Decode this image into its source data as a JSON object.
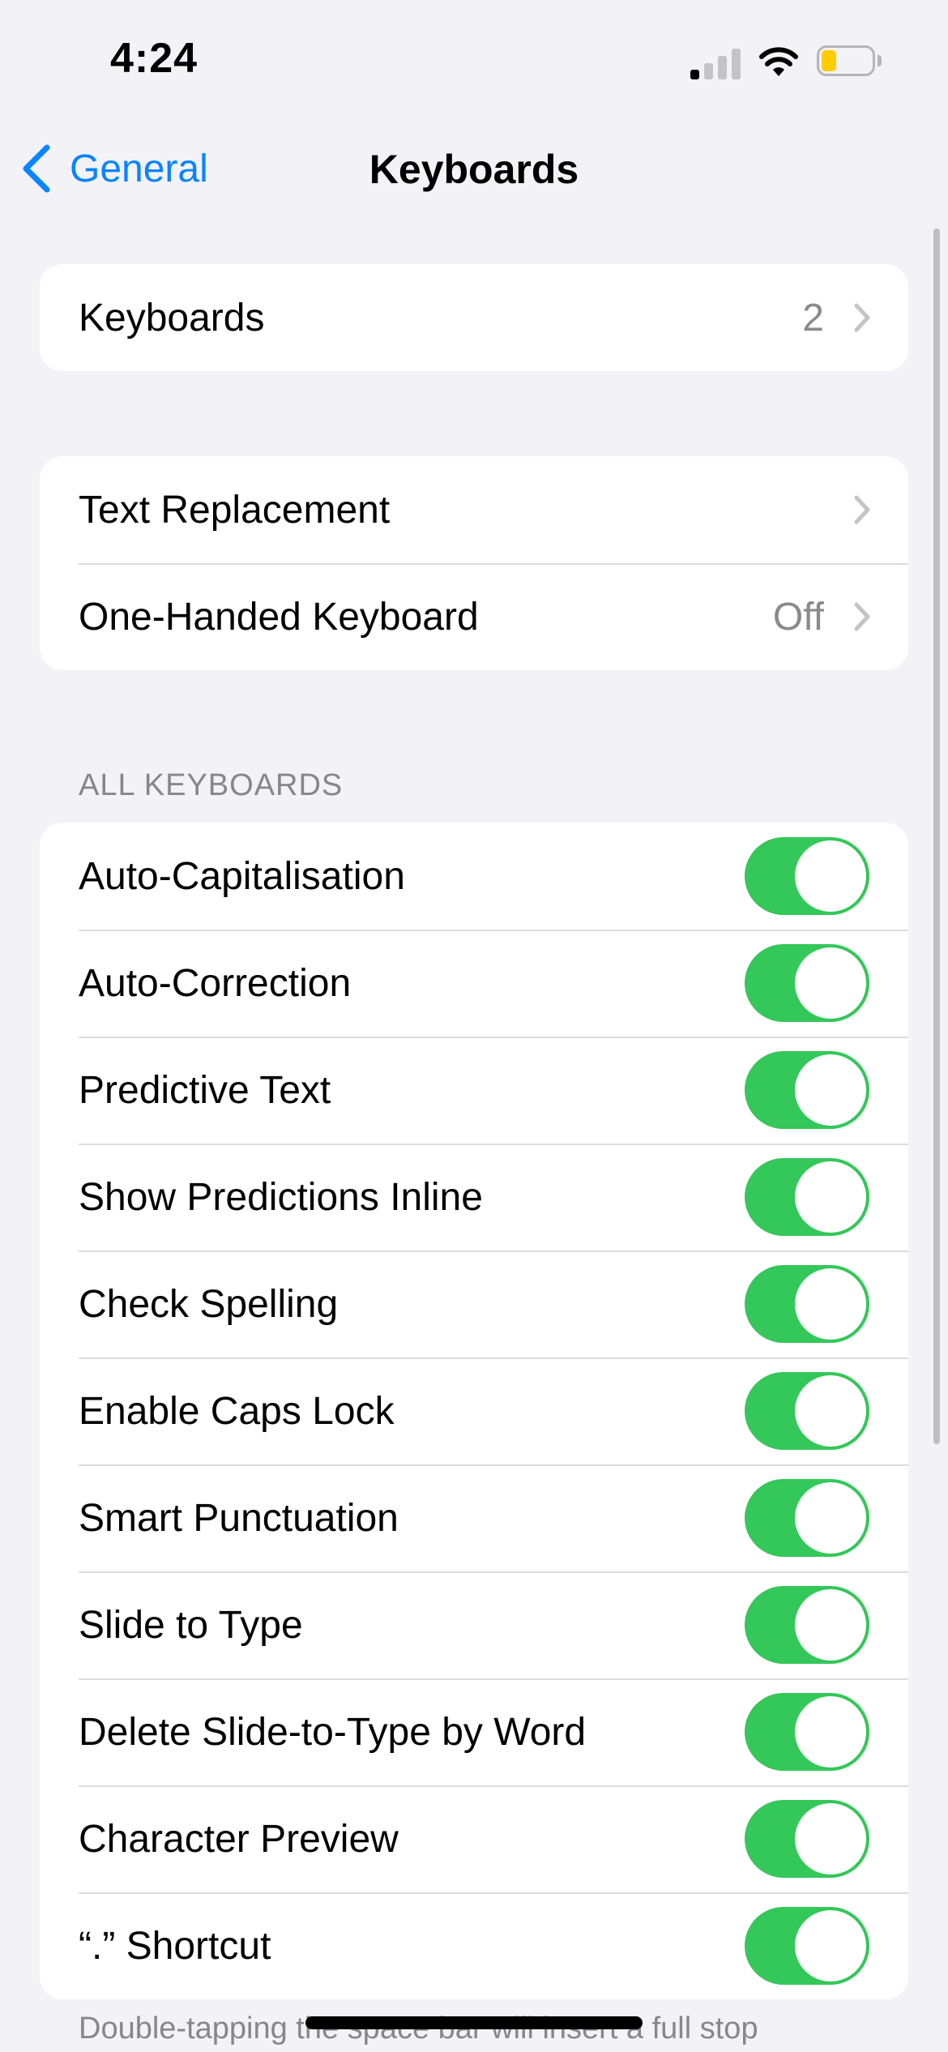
{
  "status": {
    "time": "4:24"
  },
  "nav": {
    "back_label": "General",
    "title": "Keyboards"
  },
  "group1": [
    {
      "label": "Keyboards",
      "value": "2"
    }
  ],
  "group2": [
    {
      "label": "Text Replacement",
      "value": ""
    },
    {
      "label": "One-Handed Keyboard",
      "value": "Off"
    }
  ],
  "all_keyboards": {
    "header": "ALL KEYBOARDS",
    "items": [
      {
        "label": "Auto-Capitalisation",
        "on": true
      },
      {
        "label": "Auto-Correction",
        "on": true
      },
      {
        "label": "Predictive Text",
        "on": true
      },
      {
        "label": "Show Predictions Inline",
        "on": true
      },
      {
        "label": "Check Spelling",
        "on": true
      },
      {
        "label": "Enable Caps Lock",
        "on": true
      },
      {
        "label": "Smart Punctuation",
        "on": true
      },
      {
        "label": "Slide to Type",
        "on": true
      },
      {
        "label": "Delete Slide-to-Type by Word",
        "on": true
      },
      {
        "label": "Character Preview",
        "on": true
      },
      {
        "label": "“.” Shortcut",
        "on": true
      }
    ]
  },
  "footer": "Double-tapping the space bar will insert a full stop",
  "colors": {
    "accent": "#0a84ff",
    "toggle_on": "#34c759",
    "background": "#f2f2f7"
  }
}
